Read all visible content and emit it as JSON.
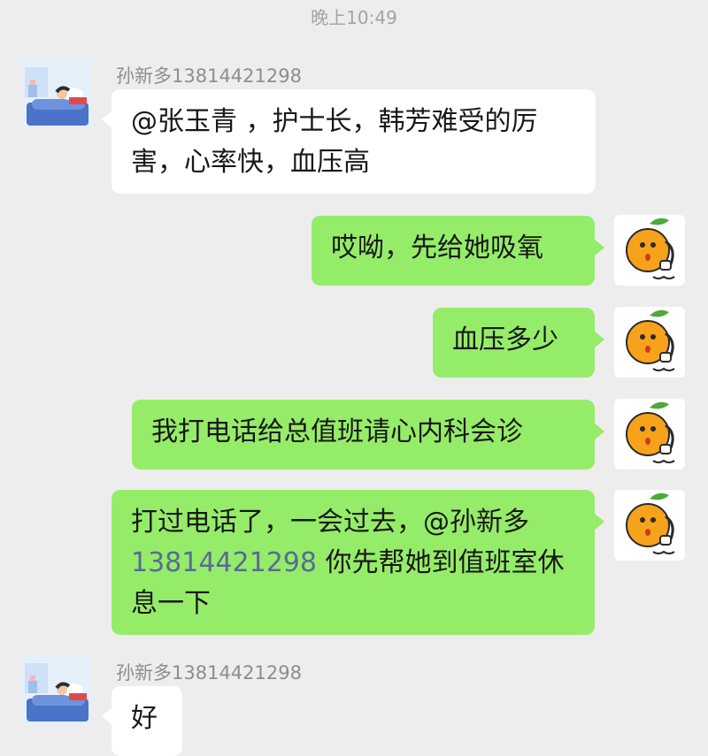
{
  "chat": {
    "timestamp": "晚上10:49",
    "messages": [
      {
        "direction": "in",
        "sender": "孙新多13814421298",
        "text": "@张玉青 ，护士长，韩芳难受的厉害，心率快，血压高"
      },
      {
        "direction": "out",
        "text": "哎呦，先给她吸氧"
      },
      {
        "direction": "out",
        "text": "血压多少"
      },
      {
        "direction": "out",
        "text": "我打电话给总值班请心内科会诊"
      },
      {
        "direction": "out",
        "text_before": "打过电话了，一会过去，@孙新多",
        "phone_link": "13814421298",
        "text_after": " 你先帮她到值班室休息一下"
      },
      {
        "direction": "in",
        "sender": "孙新多13814421298",
        "text": "好"
      }
    ]
  },
  "avatars": {
    "contact": {
      "icon": "sleeping-person-illustration-icon",
      "bg": "#e6f0fb",
      "accent": "#4a73c9"
    },
    "self": {
      "icon": "orange-phone-sticker-icon",
      "bg": "#ffffff",
      "accent": "#f7a21b"
    }
  },
  "colors": {
    "background": "#ededed",
    "incoming_bubble": "#ffffff",
    "outgoing_bubble": "#95ec69",
    "link": "#576b95"
  }
}
